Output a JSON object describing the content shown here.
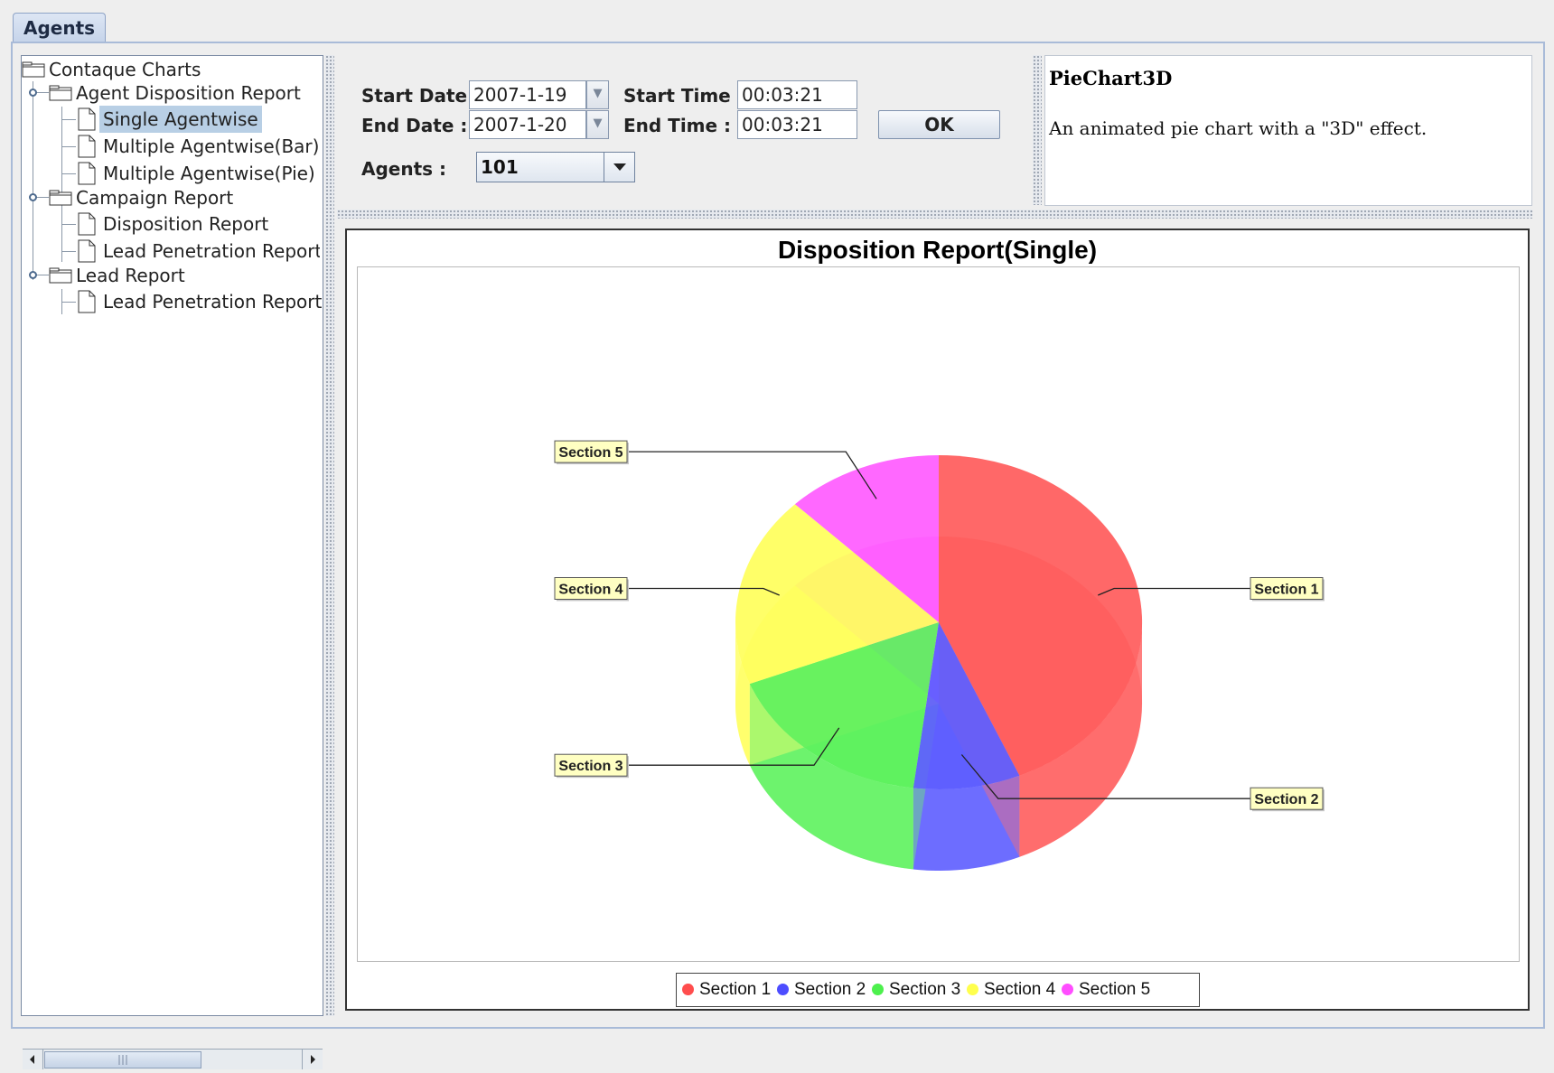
{
  "tab": {
    "label": "Agents"
  },
  "tree": {
    "root": "Contaque Charts",
    "groups": [
      {
        "label": "Agent Disposition Report",
        "children": [
          "Single Agentwise",
          "Multiple Agentwise(Bar)",
          "Multiple Agentwise(Pie)"
        ]
      },
      {
        "label": "Campaign Report",
        "children": [
          "Disposition Report",
          "Lead Penetration Report("
        ]
      },
      {
        "label": "Lead Report",
        "children": [
          "Lead Penetration Report"
        ]
      }
    ],
    "selected": "Single Agentwise"
  },
  "form": {
    "start_date_label": "Start Date :",
    "start_date": "2007-1-19",
    "end_date_label": "End Date :",
    "end_date": "2007-1-20",
    "start_time_label": "Start Time :",
    "start_time": "00:03:21",
    "end_time_label": "End Time :",
    "end_time": "00:03:21",
    "ok_label": "OK",
    "agents_label": "Agents :",
    "agents_value": "101"
  },
  "description": {
    "title": "PieChart3D",
    "text": "An animated pie chart with a \"3D\" effect."
  },
  "chart_data": {
    "type": "pie",
    "title": "Disposition Report(Single)",
    "style": "3d",
    "slices": [
      {
        "label": "Section 1",
        "value": 43.5,
        "color": "#ff4d4d"
      },
      {
        "label": "Section 2",
        "value": 8.5,
        "color": "#4d4dff"
      },
      {
        "label": "Section 3",
        "value": 17.0,
        "color": "#4df04d"
      },
      {
        "label": "Section 4",
        "value": 18.5,
        "color": "#ffff4d"
      },
      {
        "label": "Section 5",
        "value": 12.5,
        "color": "#ff4dff"
      }
    ],
    "legend": {
      "position": "bottom",
      "items": [
        "Section 1",
        "Section 2",
        "Section 3",
        "Section 4",
        "Section 5"
      ]
    }
  }
}
